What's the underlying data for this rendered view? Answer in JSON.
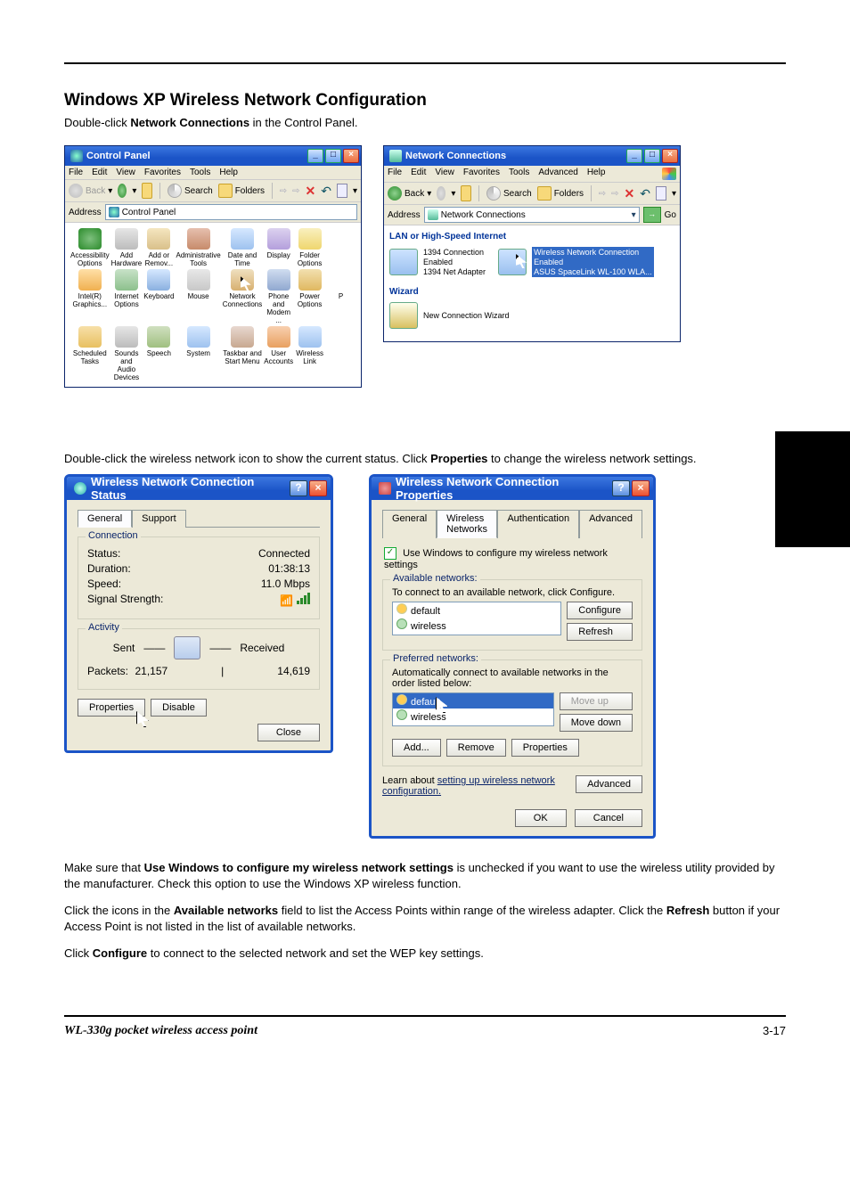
{
  "section": {
    "title": "Windows XP Wireless Network Configuration",
    "desc": "Double-click <b>Network Connections</b> in the Control Panel."
  },
  "control_panel_window": {
    "title": "Control Panel",
    "menus": [
      "File",
      "Edit",
      "View",
      "Favorites",
      "Tools",
      "Help"
    ],
    "toolbar": {
      "back": "Back",
      "search": "Search",
      "folders": "Folders"
    },
    "address_label": "Address",
    "address_value": "Control Panel",
    "items": [
      "Accessibility Options",
      "Add Hardware",
      "Add or Remov...",
      "Administrative Tools",
      "Date and Time",
      "Display",
      "Folder Options",
      "",
      "Intel(R) Graphics...",
      "Internet Options",
      "Keyboard",
      "Mouse",
      "Network Connections",
      "Phone and Modem ...",
      "Power Options",
      "P",
      "Scheduled Tasks",
      "Sounds and Audio Devices",
      "Speech",
      "System",
      "Taskbar and Start Menu",
      "User Accounts",
      "Wireless Link",
      ""
    ],
    "selected_index": 12
  },
  "network_window": {
    "title": "Network Connections",
    "menus": [
      "File",
      "Edit",
      "View",
      "Favorites",
      "Tools",
      "Advanced",
      "Help"
    ],
    "toolbar": {
      "back": "Back",
      "search": "Search",
      "folders": "Folders"
    },
    "address_label": "Address",
    "address_value": "Network Connections",
    "go": "Go",
    "group1": "LAN or High-Speed Internet",
    "conn1": {
      "name": "1394 Connection",
      "status": "Enabled",
      "adapter": "1394 Net Adapter"
    },
    "conn2": {
      "name": "Wireless Network Connection",
      "status": "Enabled",
      "adapter": "ASUS SpaceLink WL-100 WLA..."
    },
    "group2": "Wizard",
    "wizard": "New Connection Wizard"
  },
  "mid_text": "Double-click the wireless network icon to show the current status.  Click <b>Properties</b> to change the wireless network settings.",
  "status_dialog": {
    "title": "Wireless Network Connection Status",
    "tabs": [
      "General",
      "Support"
    ],
    "connection": {
      "legend": "Connection",
      "status_label": "Status:",
      "status_value": "Connected",
      "duration_label": "Duration:",
      "duration_value": "01:38:13",
      "speed_label": "Speed:",
      "speed_value": "11.0 Mbps",
      "signal_label": "Signal Strength:"
    },
    "activity": {
      "legend": "Activity",
      "sent": "Sent",
      "received": "Received",
      "packets_label": "Packets:",
      "packets_sent": "21,157",
      "packets_recv": "14,619"
    },
    "buttons": {
      "properties": "Properties",
      "disable": "Disable",
      "close": "Close"
    }
  },
  "properties_dialog": {
    "title": "Wireless Network Connection Properties",
    "tabs": [
      "General",
      "Wireless Networks",
      "Authentication",
      "Advanced"
    ],
    "checkbox": "Use Windows to configure my wireless network settings",
    "available": {
      "legend": "Available networks:",
      "desc": "To connect to an available network, click Configure.",
      "items": [
        "default",
        "wireless"
      ],
      "configure": "Configure",
      "refresh": "Refresh"
    },
    "preferred": {
      "legend": "Preferred networks:",
      "desc": "Automatically connect to available networks in the order listed below:",
      "items": [
        "default",
        "wireless"
      ],
      "moveup": "Move up",
      "movedown": "Move down",
      "add": "Add...",
      "remove": "Remove",
      "props": "Properties"
    },
    "learn_prefix": "Learn about ",
    "learn_link": "setting up wireless network configuration.",
    "advanced": "Advanced",
    "ok": "OK",
    "cancel": "Cancel"
  },
  "bottom": {
    "p1": "Make sure that <b>Use Windows to configure my wireless network settings</b> is unchecked if you want to use the wireless utility provided by the manufacturer.  Check this option to use the Windows XP wireless function.",
    "p2": "Click the icons in the <b>Available networks</b> field to list the Access Points within range of the wireless adapter.  Click the <b>Refresh</b> button if your Access Point is not listed in the list of available networks.",
    "p3": "Click <b>Configure</b> to connect to the selected network and set the WEP key settings."
  },
  "footer": {
    "model": "WL-330g pocket wireless access point",
    "page": "3-17"
  }
}
